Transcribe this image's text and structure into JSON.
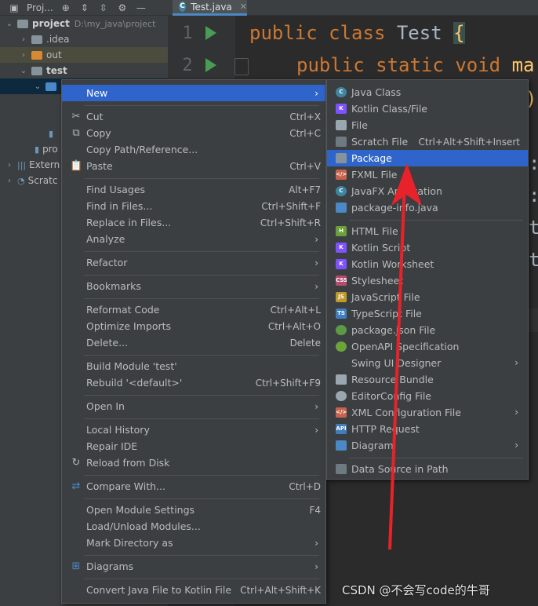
{
  "toolbar": {
    "project_tab": "Proj...",
    "editor_tab": "Test.java"
  },
  "tree": {
    "project_name": "project",
    "project_path": "D:\\my_java\\project",
    "idea": ".idea",
    "out": "out",
    "test": "test",
    "pro_item": "pro",
    "external": "Extern",
    "scratches": "Scratc"
  },
  "editor": {
    "line1_no": "1",
    "line2_no": "2",
    "line1_kw1": "public",
    "line1_kw2": "class",
    "line1_name": "Test",
    "line1_brace": "{",
    "line2_kw1": "public",
    "line2_kw2": "static",
    "line2_kw3": "void",
    "line2_name": "ma",
    "frag1": ");",
    "frag2": ":",
    "frag3": ":",
    "frag4": "tl",
    "frag5": "tl"
  },
  "menu": {
    "items": [
      {
        "label": "New",
        "shortcut": "",
        "arrow": true
      },
      {
        "label": "Cut",
        "shortcut": "Ctrl+X"
      },
      {
        "label": "Copy",
        "shortcut": "Ctrl+C"
      },
      {
        "label": "Copy Path/Reference...",
        "shortcut": ""
      },
      {
        "label": "Paste",
        "shortcut": "Ctrl+V"
      },
      {
        "label": "Find Usages",
        "shortcut": "Alt+F7"
      },
      {
        "label": "Find in Files...",
        "shortcut": "Ctrl+Shift+F"
      },
      {
        "label": "Replace in Files...",
        "shortcut": "Ctrl+Shift+R"
      },
      {
        "label": "Analyze",
        "shortcut": "",
        "arrow": true
      },
      {
        "label": "Refactor",
        "shortcut": "",
        "arrow": true
      },
      {
        "label": "Bookmarks",
        "shortcut": "",
        "arrow": true
      },
      {
        "label": "Reformat Code",
        "shortcut": "Ctrl+Alt+L"
      },
      {
        "label": "Optimize Imports",
        "shortcut": "Ctrl+Alt+O"
      },
      {
        "label": "Delete...",
        "shortcut": "Delete"
      },
      {
        "label": "Build Module 'test'",
        "shortcut": ""
      },
      {
        "label": "Rebuild '<default>'",
        "shortcut": "Ctrl+Shift+F9"
      },
      {
        "label": "Open In",
        "shortcut": "",
        "arrow": true
      },
      {
        "label": "Local History",
        "shortcut": "",
        "arrow": true
      },
      {
        "label": "Repair IDE",
        "shortcut": ""
      },
      {
        "label": "Reload from Disk",
        "shortcut": ""
      },
      {
        "label": "Compare With...",
        "shortcut": "Ctrl+D"
      },
      {
        "label": "Open Module Settings",
        "shortcut": "F4"
      },
      {
        "label": "Load/Unload Modules...",
        "shortcut": ""
      },
      {
        "label": "Mark Directory as",
        "shortcut": "",
        "arrow": true
      },
      {
        "label": "Diagrams",
        "shortcut": "",
        "arrow": true
      },
      {
        "label": "Convert Java File to Kotlin File",
        "shortcut": "Ctrl+Alt+Shift+K"
      }
    ]
  },
  "submenu": {
    "items": [
      {
        "label": "Java Class",
        "shortcut": ""
      },
      {
        "label": "Kotlin Class/File",
        "shortcut": ""
      },
      {
        "label": "File",
        "shortcut": ""
      },
      {
        "label": "Scratch File",
        "shortcut": "Ctrl+Alt+Shift+Insert"
      },
      {
        "label": "Package",
        "shortcut": ""
      },
      {
        "label": "FXML File",
        "shortcut": ""
      },
      {
        "label": "JavaFX Application",
        "shortcut": ""
      },
      {
        "label": "package-info.java",
        "shortcut": ""
      },
      {
        "label": "HTML File",
        "shortcut": ""
      },
      {
        "label": "Kotlin Script",
        "shortcut": ""
      },
      {
        "label": "Kotlin Worksheet",
        "shortcut": ""
      },
      {
        "label": "Stylesheet",
        "shortcut": ""
      },
      {
        "label": "JavaScript File",
        "shortcut": ""
      },
      {
        "label": "TypeScript File",
        "shortcut": ""
      },
      {
        "label": "package.json File",
        "shortcut": ""
      },
      {
        "label": "OpenAPI Specification",
        "shortcut": ""
      },
      {
        "label": "Swing UI Designer",
        "shortcut": "",
        "arrow": true
      },
      {
        "label": "Resource Bundle",
        "shortcut": ""
      },
      {
        "label": "EditorConfig File",
        "shortcut": ""
      },
      {
        "label": "XML Configuration File",
        "shortcut": "",
        "arrow": true
      },
      {
        "label": "HTTP Request",
        "shortcut": ""
      },
      {
        "label": "Diagram",
        "shortcut": "",
        "arrow": true
      },
      {
        "label": "Data Source in Path",
        "shortcut": ""
      }
    ]
  },
  "icon_texts": {
    "java_c": "C",
    "kotlin": "K",
    "html": "H",
    "css": "CSS",
    "js": "JS",
    "ts": "TS",
    "fxml": "</>",
    "api": "API",
    "xml": "</>"
  },
  "colors": {
    "highlight": "#2f65ca",
    "annotation_arrow": "#e8222a"
  },
  "watermark": "CSDN @不会写code的牛哥"
}
